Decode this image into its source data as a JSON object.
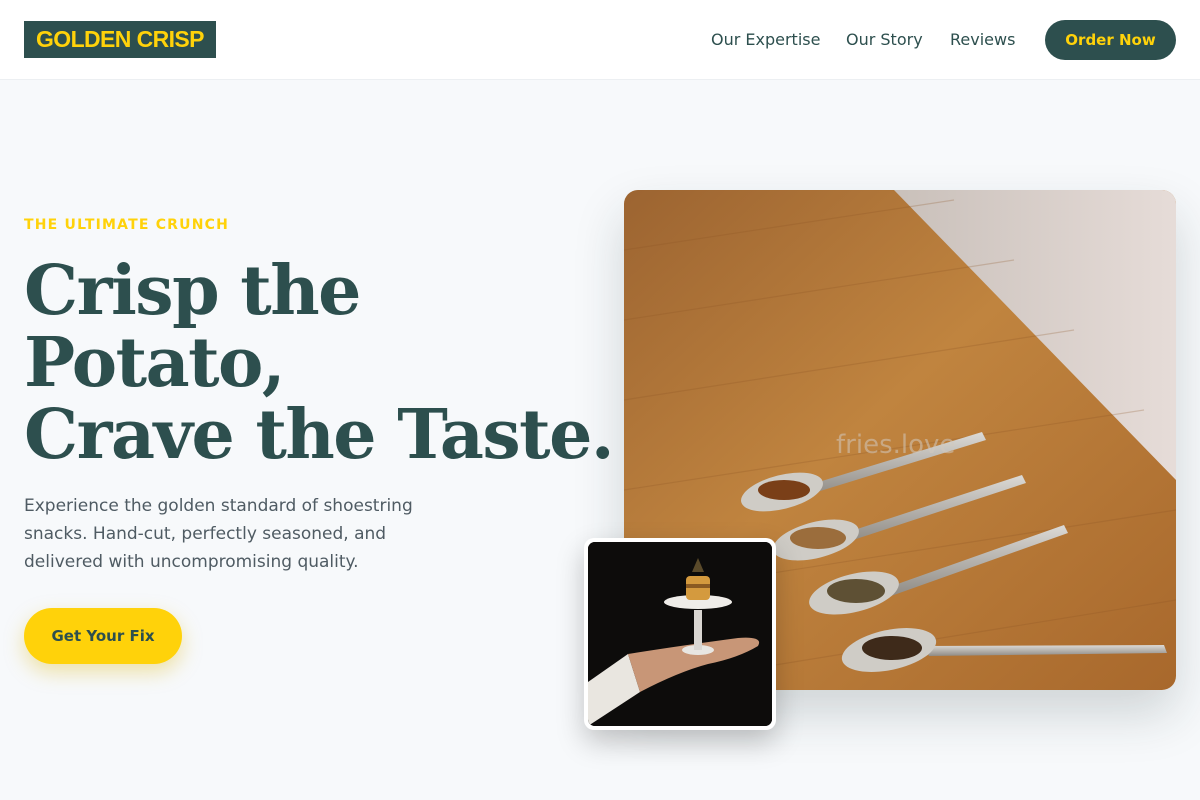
{
  "header": {
    "logo": "GOLDEN CRISP",
    "nav": [
      "Our Expertise",
      "Our Story",
      "Reviews"
    ],
    "order_button": "Order Now"
  },
  "hero": {
    "eyebrow": "THE ULTIMATE CRUNCH",
    "headline": [
      "Crisp the",
      "Potato,",
      "Crave the Taste."
    ],
    "subtext": "Experience the golden standard of shoestring snacks. Hand-cut, perfectly seasoned, and delivered with uncompromising quality.",
    "cta": "Get Your Fix"
  },
  "images": {
    "main_watermark": "fries.love"
  },
  "colors": {
    "brand_dark": "#2d4f4e",
    "brand_yellow": "#ffd20a",
    "background": "#f7f9fb"
  }
}
